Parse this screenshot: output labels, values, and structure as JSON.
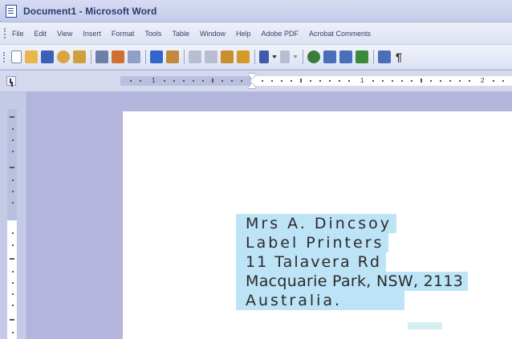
{
  "window": {
    "title": "Document1 - Microsoft Word"
  },
  "menubar": {
    "items": [
      "File",
      "Edit",
      "View",
      "Insert",
      "Format",
      "Tools",
      "Table",
      "Window",
      "Help",
      "Adobe PDF",
      "Acrobat Comments"
    ]
  },
  "toolbar": {
    "buttons": [
      {
        "icon": "new-document-icon",
        "color": "#ffffff"
      },
      {
        "icon": "open-folder-icon",
        "color": "#e8b64a"
      },
      {
        "icon": "save-icon",
        "color": "#3d5fb4"
      },
      {
        "icon": "permission-icon",
        "color": "#d9a441"
      },
      {
        "icon": "email-icon",
        "color": "#d0a040"
      },
      {
        "icon": "print-icon",
        "color": "#6e7fa8"
      },
      {
        "icon": "print-preview-icon",
        "color": "#d07030"
      },
      {
        "icon": "spelling-icon",
        "color": "#3366cc"
      },
      {
        "icon": "research-icon",
        "color": "#c08a3a"
      },
      {
        "icon": "cut-icon",
        "color": "#9aa0b8"
      },
      {
        "icon": "copy-icon",
        "color": "#9aa0b8"
      },
      {
        "icon": "paste-icon",
        "color": "#c8902c"
      },
      {
        "icon": "format-painter-icon",
        "color": "#d39a2a"
      },
      {
        "icon": "undo-icon",
        "color": "#3e5aa8"
      },
      {
        "icon": "redo-icon",
        "color": "#9aa0b8"
      },
      {
        "icon": "hyperlink-icon",
        "color": "#3a7d3a"
      },
      {
        "icon": "tables-borders-icon",
        "color": "#4a6fb8"
      },
      {
        "icon": "insert-table-icon",
        "color": "#4a6fb8"
      },
      {
        "icon": "insert-excel-icon",
        "color": "#3a8a3a"
      },
      {
        "icon": "columns-icon",
        "color": "#4a6fb8"
      }
    ],
    "show_hide_symbol": "¶"
  },
  "ruler": {
    "numbers": [
      "1",
      "1",
      "2"
    ]
  },
  "document": {
    "address_lines": [
      "Mrs A. Dincsoy",
      "Label Printers",
      "11 Talavera Rd",
      "Macquarie Park, NSW, 2113",
      "Australia."
    ],
    "highlight_color": "#bde3f6"
  }
}
